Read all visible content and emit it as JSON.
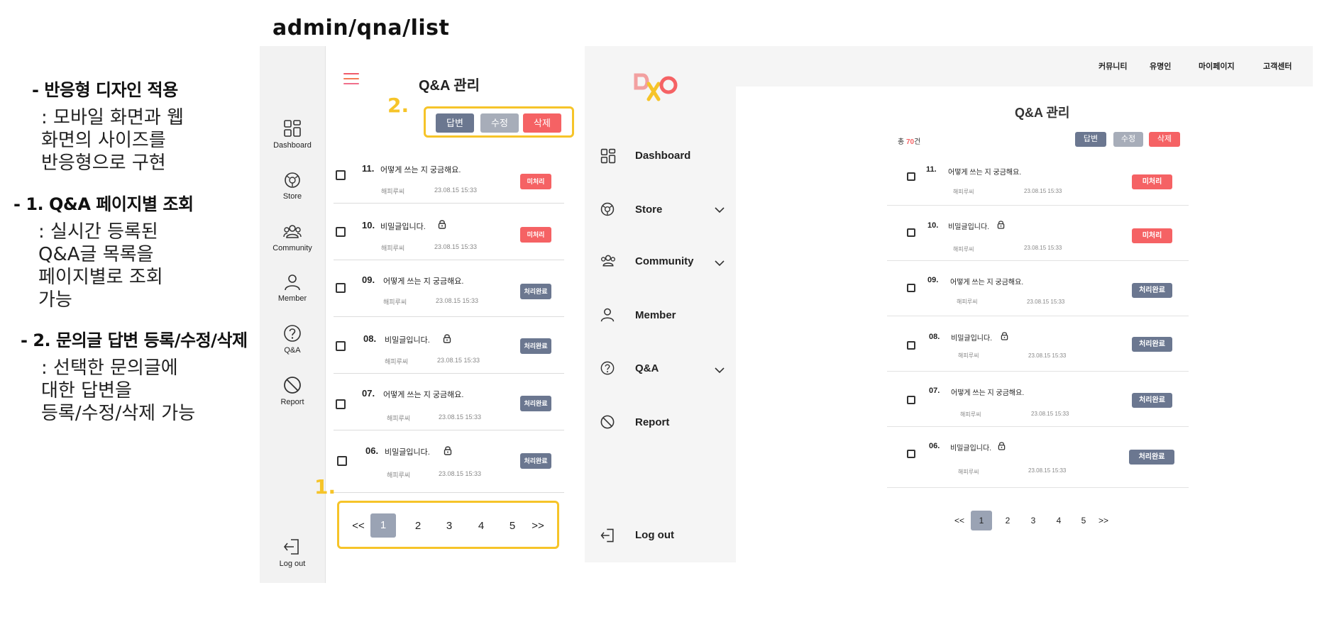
{
  "page_path": "admin/qna/list",
  "notes": [
    {
      "heading": "- 반응형 디자인 적용",
      "body": ": 모바일 화면과 웹\n화면의 사이즈를\n반응형으로 구현"
    },
    {
      "heading": "- 1. Q&A 페이지별 조회",
      "body": ": 실시간 등록된\nQ&A글 목록을\n페이지별로 조회\n가능"
    },
    {
      "heading": "- 2. 문의글 답변 등록/수정/삭제",
      "body": ": 선택한 문의글에\n대한 답변을\n등록/수정/삭제 가능"
    }
  ],
  "markers": {
    "one": "1.",
    "two": "2."
  },
  "mobile": {
    "title": "Q&A 관리",
    "rail": [
      {
        "label": "Dashboard",
        "icon": "dashboard-icon"
      },
      {
        "label": "Store",
        "icon": "store-icon"
      },
      {
        "label": "Community",
        "icon": "community-icon"
      },
      {
        "label": "Member",
        "icon": "member-icon"
      },
      {
        "label": "Q&A",
        "icon": "qna-icon"
      },
      {
        "label": "Report",
        "icon": "report-icon"
      }
    ],
    "logout": "Log out",
    "actions": {
      "answer": "답변",
      "edit": "수정",
      "delete": "삭제"
    },
    "rows": [
      {
        "num": "11.",
        "title": "어떻게 쓰는 지 궁금해요.",
        "author": "해피루씨",
        "date": "23.08.15 15:33",
        "status": "미처리",
        "locked": false
      },
      {
        "num": "10.",
        "title": "비밀글입니다.",
        "author": "해피루씨",
        "date": "23.08.15 15:33",
        "status": "미처리",
        "locked": true
      },
      {
        "num": "09.",
        "title": "어떻게 쓰는 지 궁금해요.",
        "author": "해피루씨",
        "date": "23.08.15 15:33",
        "status": "처리완료",
        "locked": false
      },
      {
        "num": "08.",
        "title": "비밀글입니다.",
        "author": "해피루씨",
        "date": "23.08.15 15:33",
        "status": "처리완료",
        "locked": true
      },
      {
        "num": "07.",
        "title": "어떻게 쓰는 지 궁금해요.",
        "author": "해피루씨",
        "date": "23.08.15 15:33",
        "status": "처리완료",
        "locked": false
      },
      {
        "num": "06.",
        "title": "비밀글입니다.",
        "author": "해피루씨",
        "date": "23.08.15 15:33",
        "status": "처리완료",
        "locked": true
      }
    ],
    "pagination": {
      "prev": "<<",
      "pages": [
        "1",
        "2",
        "3",
        "4",
        "5"
      ],
      "next": ">>",
      "current": "1"
    }
  },
  "web": {
    "logo_text": "DXO",
    "topnav": [
      "커뮤니티",
      "유명인",
      "마이페이지",
      "고객센터"
    ],
    "side": [
      {
        "label": "Dashboard",
        "icon": "dashboard-icon",
        "expandable": false
      },
      {
        "label": "Store",
        "icon": "store-icon",
        "expandable": true
      },
      {
        "label": "Community",
        "icon": "community-icon",
        "expandable": true
      },
      {
        "label": "Member",
        "icon": "member-icon",
        "expandable": false
      },
      {
        "label": "Q&A",
        "icon": "qna-icon",
        "expandable": true
      },
      {
        "label": "Report",
        "icon": "report-icon",
        "expandable": false
      }
    ],
    "logout": "Log out",
    "title": "Q&A 관리",
    "total_prefix": "총 ",
    "total_count": "70",
    "total_suffix": "건",
    "actions": {
      "answer": "답변",
      "edit": "수정",
      "delete": "삭제"
    },
    "rows": [
      {
        "num": "11.",
        "title": "어떻게 쓰는 지 궁금해요.",
        "author": "해피루씨",
        "date": "23.08.15 15:33",
        "status": "미처리",
        "locked": false
      },
      {
        "num": "10.",
        "title": "비밀글입니다.",
        "author": "해피루씨",
        "date": "23.08.15 15:33",
        "status": "미처리",
        "locked": true
      },
      {
        "num": "09.",
        "title": "어떻게 쓰는 지 궁금해요.",
        "author": "해피루씨",
        "date": "23.08.15 15:33",
        "status": "처리완료",
        "locked": false
      },
      {
        "num": "08.",
        "title": "비밀글입니다.",
        "author": "해피루씨",
        "date": "23.08.15 15:33",
        "status": "처리완료",
        "locked": true
      },
      {
        "num": "07.",
        "title": "어떻게 쓰는 지 궁금해요.",
        "author": "해피루씨",
        "date": "23.08.15 15:33",
        "status": "처리완료",
        "locked": false
      },
      {
        "num": "06.",
        "title": "비밀글입니다.",
        "author": "해피루씨",
        "date": "23.08.15 15:33",
        "status": "처리완료",
        "locked": true
      }
    ],
    "pagination": {
      "prev": "<<",
      "pages": [
        "1",
        "2",
        "3",
        "4",
        "5"
      ],
      "next": ">>",
      "current": "1"
    }
  },
  "colors": {
    "accent_red": "#f56264",
    "slate": "#6b7790",
    "gray_btn": "#a7adb9",
    "highlight": "#f6c429"
  }
}
